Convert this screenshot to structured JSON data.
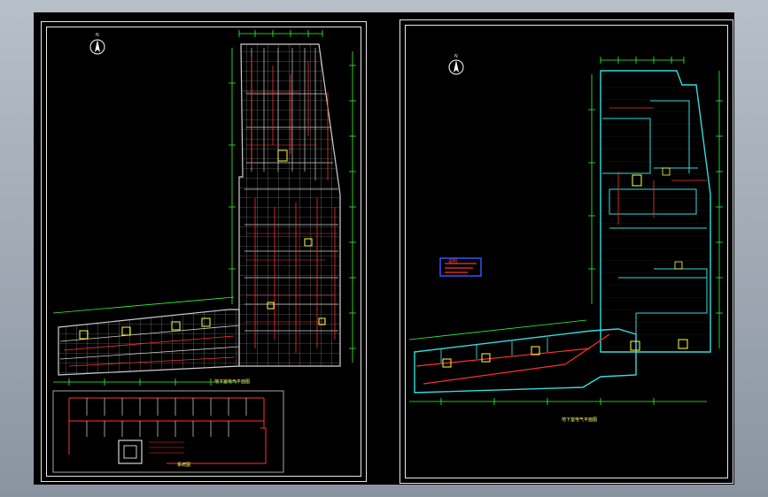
{
  "sheet_left": {
    "plan_title": "地下室电气平面图",
    "schematic_caption": "系统图",
    "north_label": "N"
  },
  "sheet_right": {
    "plan_title": "地下室电气平面图",
    "north_label": "N",
    "note_box": "说明"
  },
  "colors": {
    "background": "#000000",
    "frame": "#e6e6e6",
    "walls": "#b9b9b9",
    "dimension": "#33ff33",
    "wiring": "#ff3030",
    "cyan_walls": "#33dddd",
    "yellow_devices": "#ffff44",
    "note_blue": "#3355ff"
  }
}
